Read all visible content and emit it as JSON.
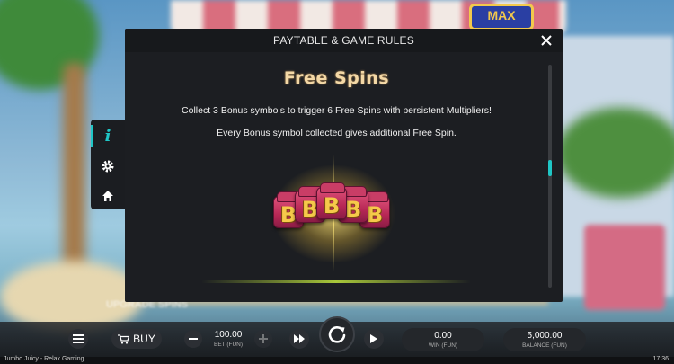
{
  "modal": {
    "title": "PAYTABLE & GAME RULES",
    "close_icon": "close-icon",
    "section_title": "Free Spins",
    "line1": "Collect 3 Bonus symbols to trigger 6 Free Spins with persistent Multipliers!",
    "line2": "Every Bonus symbol collected gives additional Free Spin.",
    "dice_letters": [
      "B",
      "B",
      "B",
      "B",
      "B"
    ]
  },
  "sidemenu": {
    "items": [
      {
        "icon": "info-icon",
        "glyph": "i",
        "active": true
      },
      {
        "icon": "gear-icon",
        "glyph": "⚙"
      },
      {
        "icon": "home-icon",
        "glyph": "⌂"
      }
    ]
  },
  "background": {
    "max_badge": "MAX",
    "upgrade_text": "UPGRADE SPINS"
  },
  "bottombar": {
    "buy_label": "BUY",
    "bet_value": "100.00",
    "bet_label": "BET (FUN)",
    "win_value": "0.00",
    "win_label": "WIN (FUN)",
    "balance_value": "5,000.00",
    "balance_label": "BALANCE (FUN)"
  },
  "status": {
    "game_name": "Jumbo Juicy - Relax Gaming",
    "time": "17:36"
  },
  "colors": {
    "accent": "#1fc6c6",
    "title_gold": "#f3d8a6",
    "die_pink": "#c93d66",
    "die_letter": "#f6c94a"
  }
}
